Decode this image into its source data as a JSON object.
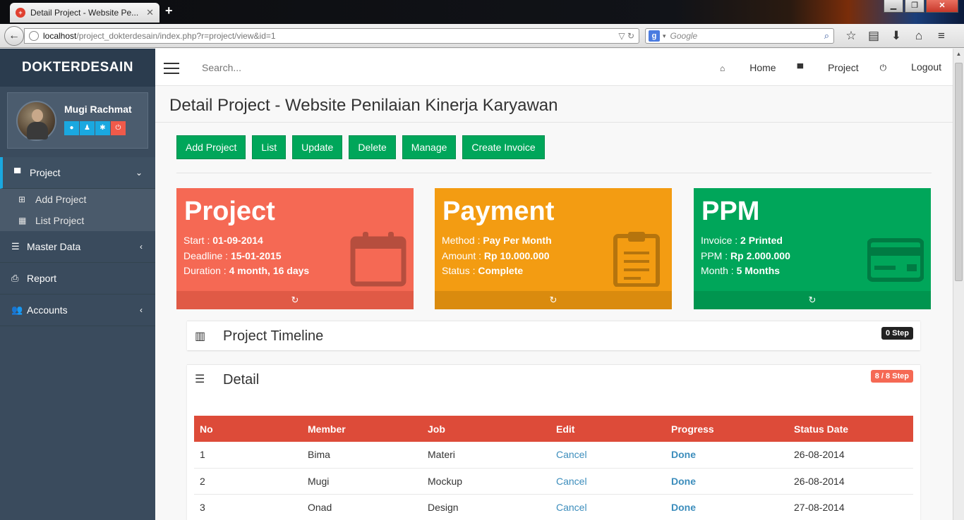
{
  "browser": {
    "tab_title": "Detail Project - Website Pe...",
    "url_host": "localhost",
    "url_path": "/project_dokterdesain/index.php?r=project/view&id=1",
    "search_placeholder": "Google"
  },
  "sidebar": {
    "brand": "DOKTERDESAIN",
    "user_name": "Mugi Rachmat",
    "menu": [
      {
        "label": "Project",
        "active": true
      },
      {
        "label": "Master Data"
      },
      {
        "label": "Report"
      },
      {
        "label": "Accounts"
      }
    ],
    "submenu": [
      {
        "label": "Add Project"
      },
      {
        "label": "List Project"
      }
    ]
  },
  "header": {
    "search_placeholder": "Search...",
    "nav": [
      "Home",
      "Project",
      "Logout"
    ]
  },
  "content": {
    "title": "Detail Project - Website Penilaian Kinerja Karyawan",
    "buttons": [
      "Add Project",
      "List",
      "Update",
      "Delete",
      "Manage",
      "Create Invoice"
    ],
    "boxes": {
      "project": {
        "title": "Project",
        "lines": [
          {
            "label": "Start : ",
            "value": "01-09-2014"
          },
          {
            "label": "Deadline : ",
            "value": "15-01-2015"
          },
          {
            "label": "Duration : ",
            "value": "4 month, 16 days"
          }
        ],
        "color": "#f56954"
      },
      "payment": {
        "title": "Payment",
        "lines": [
          {
            "label": "Method : ",
            "value": "Pay Per Month"
          },
          {
            "label": "Amount : ",
            "value": "Rp 10.000.000"
          },
          {
            "label": "Status : ",
            "value": "Complete"
          }
        ],
        "color": "#f39c12"
      },
      "ppm": {
        "title": "PPM",
        "lines": [
          {
            "label": "Invoice : ",
            "value": "2 Printed"
          },
          {
            "label": "PPM : ",
            "value": "Rp 2.000.000"
          },
          {
            "label": "Month : ",
            "value": "5 Months"
          }
        ],
        "color": "#00a65a"
      }
    },
    "timeline": {
      "title": "Project Timeline",
      "badge": "0 Step"
    },
    "detail": {
      "title": "Detail",
      "badge": "8 / 8 Step",
      "columns": [
        "No",
        "Member",
        "Job",
        "Edit",
        "Progress",
        "Status Date"
      ],
      "rows": [
        [
          "1",
          "Bima",
          "Materi",
          "Cancel",
          "Done",
          "26-08-2014"
        ],
        [
          "2",
          "Mugi",
          "Mockup",
          "Cancel",
          "Done",
          "26-08-2014"
        ],
        [
          "3",
          "Onad",
          "Design",
          "Cancel",
          "Done",
          "27-08-2014"
        ]
      ]
    }
  }
}
